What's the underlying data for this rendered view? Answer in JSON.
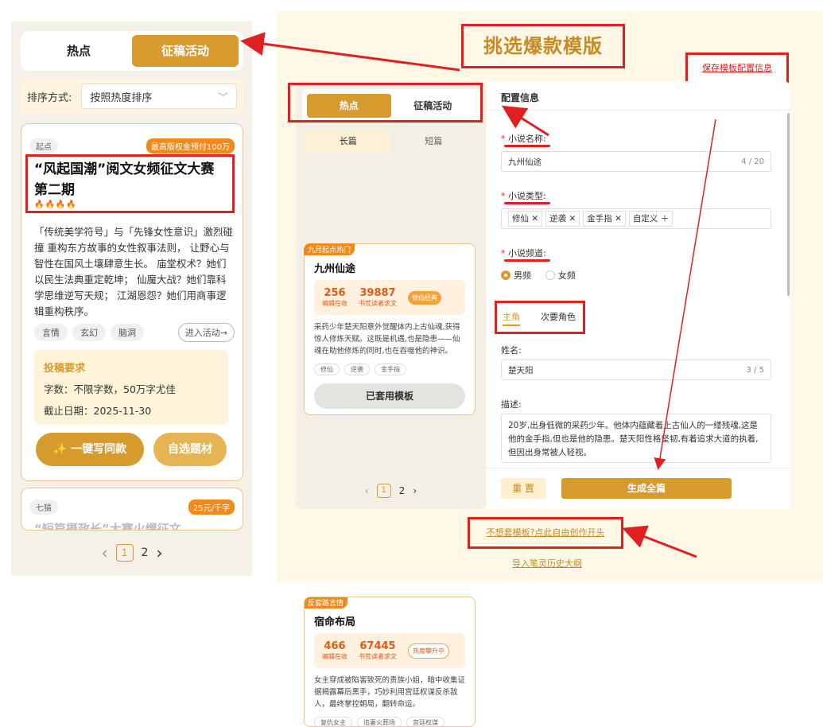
{
  "left": {
    "tabs": [
      "热点",
      "征稿活动"
    ],
    "sort_label": "排序方式:",
    "sort_value": "按照热度排序",
    "card1": {
      "source": "起点",
      "badge": "最高版权金预付100万",
      "title": "“风起国潮”阅文女频征文大赛第二期",
      "fire": "🔥🔥🔥🔥",
      "desc": "「传统美学符号」与「先锋女性意识」激烈碰撞 重构东方故事的女性叙事法则， 让野心与智性在国风土壤肆意生长。 庙堂权术？她们以民生法典重定乾坤； 仙魔大战？她们靠科学思维逆写天规； 江湖恩怨？她们用商事逻辑重构秩序。",
      "tags": [
        "言情",
        "玄幻",
        "脑洞"
      ],
      "enter": "进入活动→",
      "req_title": "投稿要求",
      "req_words": "字数：不限字数，50万字尤佳",
      "req_deadline": "截止日期：2025-11-30",
      "btn1": "✨ 一键写同款",
      "btn2": "自选题材"
    },
    "card2": {
      "source": "七猫",
      "badge": "25元/千字",
      "title": "“短篇摄政长”大赛火爆征文"
    },
    "pager": {
      "prev": "‹",
      "p1": "1",
      "p2": "2",
      "next": "›"
    }
  },
  "headline": "挑选爆款模版",
  "save_link": "保存模板配置信息",
  "mini": {
    "tabs": [
      "热点",
      "征稿活动"
    ],
    "subtabs": [
      "长篇",
      "短篇"
    ],
    "c1": {
      "corner": "九月起点热门",
      "title": "九州仙途",
      "n1": "256",
      "c1": "编辑在收",
      "n2": "39887",
      "c2": "书荒读者求文",
      "badge": "修仙经典",
      "desc": "采药少年楚天阳意外觉醒体内上古仙魂,获得惊人修炼天赋。这既是机遇,也是隐患——仙魂在助他修炼的同时,也在吞噬他的神识。",
      "tags": [
        "修仙",
        "逆袭",
        "金手指"
      ],
      "btn": "已套用模板"
    },
    "c2": {
      "corner": "反套路言情",
      "title": "宿命布局",
      "n1": "466",
      "c1": "编辑在收",
      "n2": "67445",
      "c2": "书荒读者求文",
      "badge": "热度攀升中",
      "desc": "女主穿成被陷害致死的贵族小姐，暗中收集证据揭露幕后黑手，巧妙利用宫廷权谋反杀敌人，最终掌控朝局，翻转命运。",
      "tags": [
        "复仇女主",
        "追妻火葬场",
        "宫廷权谋"
      ]
    },
    "pager": {
      "p1": "1",
      "p2": "2"
    }
  },
  "form": {
    "header": "配置信息",
    "name_label": "小说名称:",
    "name_value": "九州仙途",
    "name_count": "4 / 20",
    "type_label": "小说类型:",
    "type_tags": [
      "修仙",
      "逆袭",
      "金手指"
    ],
    "type_custom": "自定义",
    "channel_label": "小说频道:",
    "male": "男频",
    "female": "女频",
    "role_tabs": [
      "主角",
      "次要角色"
    ],
    "surname_label": "姓名:",
    "surname_value": "楚天阳",
    "surname_count": "3 / 5",
    "desc_label": "描述:",
    "desc_value": "20岁,出身低微的采药少年。他体内蕴藏着上古仙人的一缕残魂,这是他的金手指,但也是他的隐患。楚天阳性格坚韧,有着追求大道的执着,但因出身常被人轻视。",
    "reset": "重 置",
    "generate": "生成全篇"
  },
  "free_link": "不想套模板?点此自由创作开头",
  "import_link": "导入笔灵历史大纲",
  "colors": {
    "accent": "#d69a2d",
    "annotation": "#e02020"
  }
}
